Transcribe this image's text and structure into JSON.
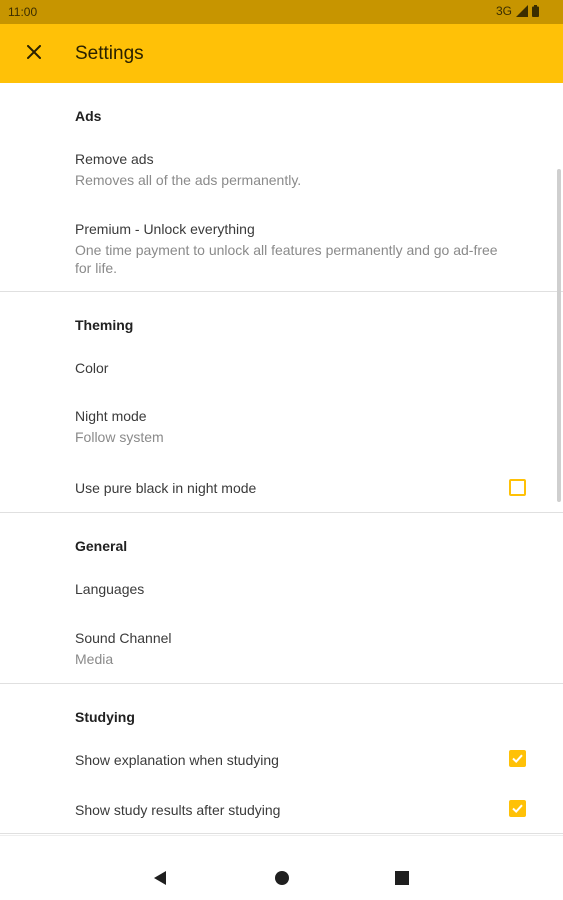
{
  "status_bar": {
    "time": "11:00",
    "network": "3G",
    "icons": [
      "signal-icon",
      "battery-icon"
    ]
  },
  "app_bar": {
    "title": "Settings",
    "close_icon": "close-icon",
    "color": "#ffc107"
  },
  "sections": {
    "ads": {
      "header": "Ads",
      "remove_ads": {
        "title": "Remove ads",
        "summary": "Removes all of the ads permanently."
      },
      "premium": {
        "title": "Premium - Unlock everything",
        "summary_line1": "One time payment to unlock all features permanently and go ad-free",
        "summary_line2": "for life."
      }
    },
    "theming": {
      "header": "Theming",
      "color": {
        "title": "Color"
      },
      "night_mode": {
        "title": "Night mode",
        "summary": "Follow system"
      },
      "pure_black": {
        "title": "Use pure black in night mode",
        "checked": false
      }
    },
    "general": {
      "header": "General",
      "languages": {
        "title": "Languages"
      },
      "sound_channel": {
        "title": "Sound Channel",
        "summary": "Media"
      }
    },
    "studying": {
      "header": "Studying",
      "show_explanation": {
        "title": "Show explanation when studying",
        "checked": true
      },
      "show_results": {
        "title": "Show study results after studying",
        "checked": true
      }
    }
  },
  "nav_bar": {
    "icons": [
      "back-icon",
      "home-icon",
      "recents-icon"
    ]
  }
}
